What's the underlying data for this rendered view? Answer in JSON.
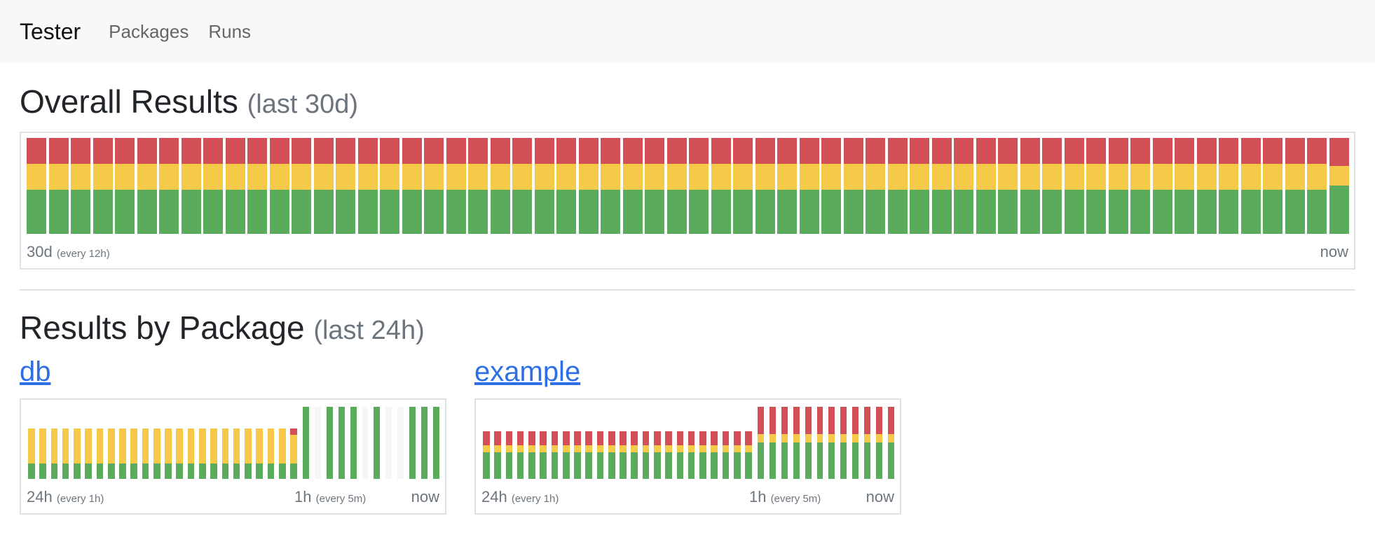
{
  "nav": {
    "brand": "Tester",
    "links": [
      "Packages",
      "Runs"
    ]
  },
  "overall": {
    "title": "Overall Results",
    "period": "(last 30d)",
    "axis": {
      "start": "30d",
      "start_note": "(every 12h)",
      "end": "now"
    },
    "bucket_count": 60,
    "typical_split": {
      "fail": 0.27,
      "warn": 0.27,
      "pass": 0.46
    },
    "last_split": {
      "fail": 0.29,
      "warn": 0.21,
      "pass": 0.5
    }
  },
  "divider": true,
  "packages_section": {
    "title": "Results by Package",
    "period": "(last 24h)",
    "packages": [
      {
        "name": "db",
        "axis": {
          "start": "24h",
          "start_note": "(every 1h)",
          "mid": "1h",
          "mid_note": "(every 5m)",
          "end": "now"
        },
        "hourly": {
          "count": 24,
          "height": 0.7,
          "split": {
            "fail": 0,
            "warn": 0.7,
            "pass": 0.3
          },
          "last_split": {
            "fail": 0.12,
            "warn": 0.58,
            "pass": 0.3
          }
        },
        "five_min": {
          "count": 12,
          "height": 1.0,
          "empty_indices": [
            1,
            5,
            7,
            8
          ],
          "split": {
            "fail": 0,
            "warn": 0,
            "pass": 1
          }
        }
      },
      {
        "name": "example",
        "axis": {
          "start": "24h",
          "start_note": "(every 1h)",
          "mid": "1h",
          "mid_note": "(every 5m)",
          "end": "now"
        },
        "hourly": {
          "count": 24,
          "height": 0.66,
          "split": {
            "fail": 0.3,
            "warn": 0.14,
            "pass": 0.56
          }
        },
        "five_min": {
          "count": 12,
          "height": 1.0,
          "empty_indices": [],
          "split": {
            "fail": 0.38,
            "warn": 0.12,
            "pass": 0.5
          }
        }
      }
    ]
  }
}
